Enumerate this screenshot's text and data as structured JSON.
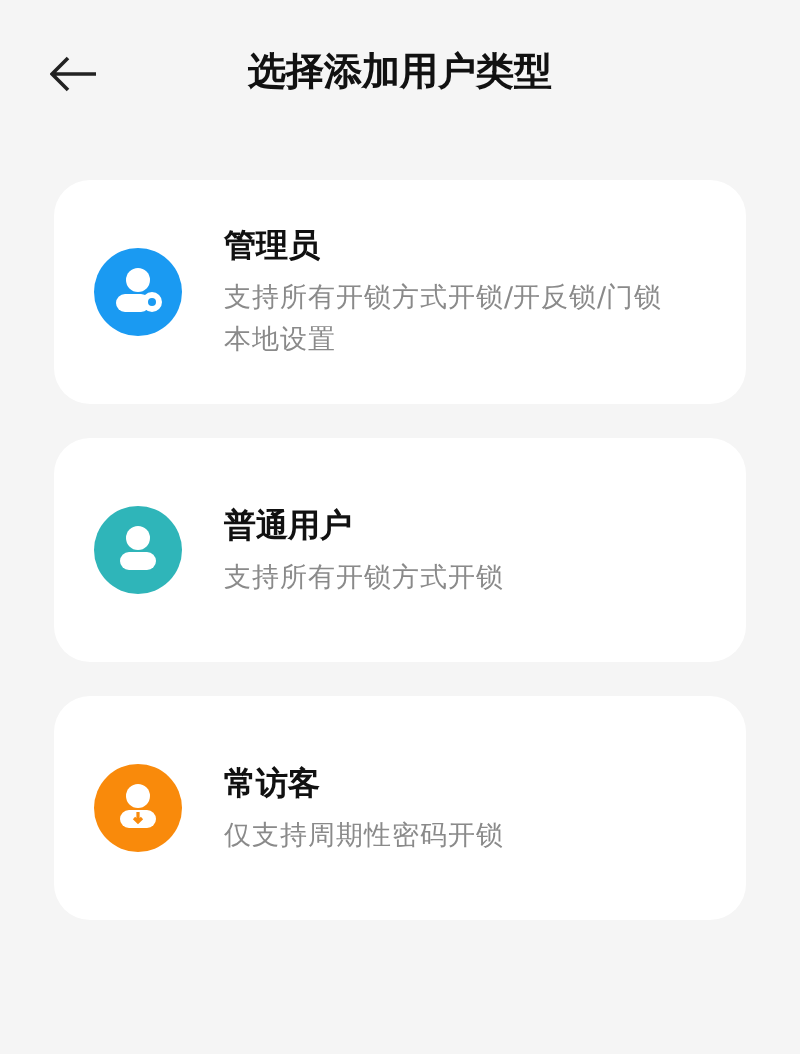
{
  "header": {
    "title": "选择添加用户类型"
  },
  "options": [
    {
      "kind": "admin",
      "color": "#1a9af2",
      "title": "管理员",
      "description": "支持所有开锁方式开锁/开反锁/门锁本地设置"
    },
    {
      "kind": "user",
      "color": "#2fb5b9",
      "title": "普通用户",
      "description": "支持所有开锁方式开锁"
    },
    {
      "kind": "guest",
      "color": "#f98a0b",
      "title": "常访客",
      "description": "仅支持周期性密码开锁"
    }
  ]
}
